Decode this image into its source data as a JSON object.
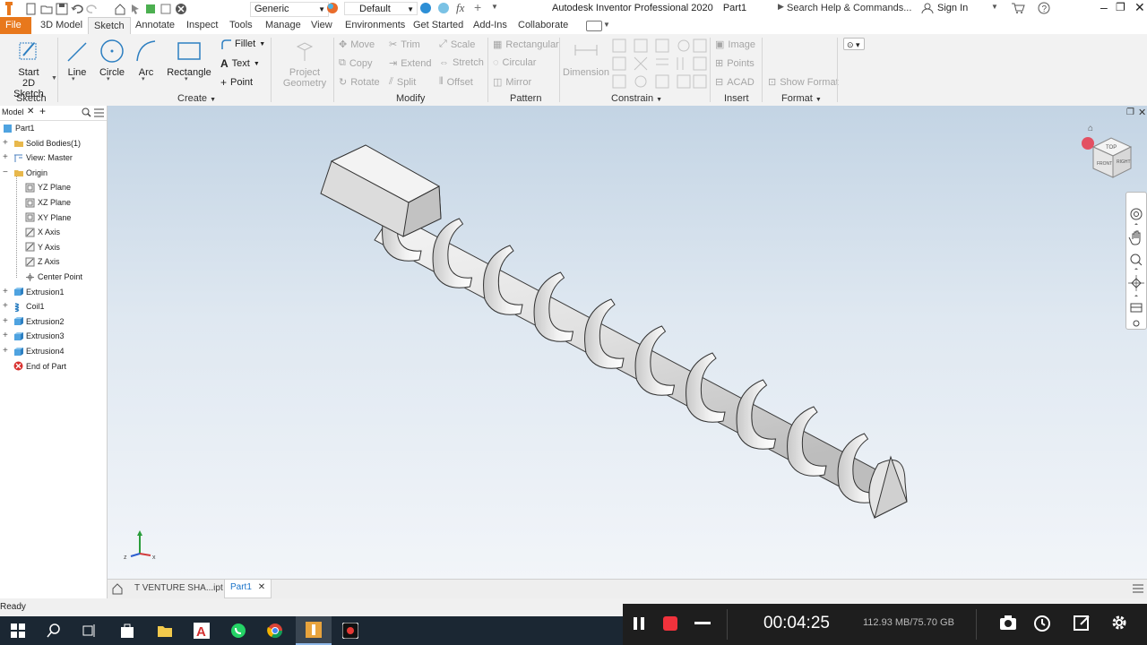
{
  "titlebar": {
    "app_title": "Autodesk Inventor Professional 2020",
    "doc_title": "Part1",
    "material": "Generic",
    "appearance": "Default",
    "search_placeholder": "Search Help & Commands...",
    "sign_in": "Sign In"
  },
  "tabs": [
    "File",
    "3D Model",
    "Sketch",
    "Annotate",
    "Inspect",
    "Tools",
    "Manage",
    "View",
    "Environments",
    "Get Started",
    "Add-Ins",
    "Collaborate"
  ],
  "active_tab": "Sketch",
  "ribbon": {
    "sketch_group": {
      "label": "Sketch",
      "start_line1": "Start",
      "start_line2": "2D Sketch"
    },
    "create_group": {
      "label": "Create",
      "line": "Line",
      "circle": "Circle",
      "arc": "Arc",
      "rectangle": "Rectangle",
      "fillet": "Fillet",
      "text": "Text",
      "point": "Point"
    },
    "project": {
      "line1": "Project",
      "line2": "Geometry"
    },
    "modify_group": {
      "label": "Modify",
      "move": "Move",
      "trim": "Trim",
      "scale": "Scale",
      "copy": "Copy",
      "extend": "Extend",
      "stretch": "Stretch",
      "rotate": "Rotate",
      "split": "Split",
      "offset": "Offset"
    },
    "pattern_group": {
      "label": "Pattern",
      "rectangular": "Rectangular",
      "circular": "Circular",
      "mirror": "Mirror"
    },
    "constrain_group": {
      "label": "Constrain",
      "dimension": "Dimension"
    },
    "insert_group": {
      "label": "Insert",
      "image": "Image",
      "points": "Points",
      "acad": "ACAD"
    },
    "format_group": {
      "label": "Format",
      "show_format": "Show Format"
    }
  },
  "browser": {
    "tab_label": "Model",
    "items": [
      {
        "label": "Part1",
        "indent": 0,
        "icon": "part-icon"
      },
      {
        "label": "Solid Bodies(1)",
        "indent": 1,
        "icon": "folder-icon"
      },
      {
        "label": "View: Master",
        "indent": 1,
        "icon": "view-icon"
      },
      {
        "label": "Origin",
        "indent": 1,
        "icon": "folder-icon"
      },
      {
        "label": "YZ Plane",
        "indent": 2,
        "icon": "plane-icon"
      },
      {
        "label": "XZ Plane",
        "indent": 2,
        "icon": "plane-icon"
      },
      {
        "label": "XY Plane",
        "indent": 2,
        "icon": "plane-icon"
      },
      {
        "label": "X Axis",
        "indent": 2,
        "icon": "axis-icon"
      },
      {
        "label": "Y Axis",
        "indent": 2,
        "icon": "axis-icon"
      },
      {
        "label": "Z Axis",
        "indent": 2,
        "icon": "axis-icon"
      },
      {
        "label": "Center Point",
        "indent": 2,
        "icon": "point-icon"
      },
      {
        "label": "Extrusion1",
        "indent": 1,
        "icon": "extrusion-icon"
      },
      {
        "label": "Coil1",
        "indent": 1,
        "icon": "coil-icon"
      },
      {
        "label": "Extrusion2",
        "indent": 1,
        "icon": "extrusion-icon"
      },
      {
        "label": "Extrusion3",
        "indent": 1,
        "icon": "extrusion-icon"
      },
      {
        "label": "Extrusion4",
        "indent": 1,
        "icon": "extrusion-icon"
      },
      {
        "label": "End of Part",
        "indent": 1,
        "icon": "end-of-part-icon"
      }
    ]
  },
  "doc_tabs": [
    {
      "label": "T VENTURE SHA...ipt",
      "active": false
    },
    {
      "label": "Part1",
      "active": true
    }
  ],
  "status": {
    "text": "Ready"
  },
  "viewcube": {
    "top": "TOP",
    "front": "FRONT",
    "right": "RIGHT"
  },
  "recorder": {
    "time": "00:04:25",
    "storage": "112.93 MB/75.70 GB"
  },
  "colors": {
    "file_tab": "#e8781c",
    "ribbon_bg": "#f2f2f2",
    "viewport_top": "#c3d4e4",
    "viewport_bottom": "#f2f5f9",
    "taskbar": "#1b2733"
  }
}
